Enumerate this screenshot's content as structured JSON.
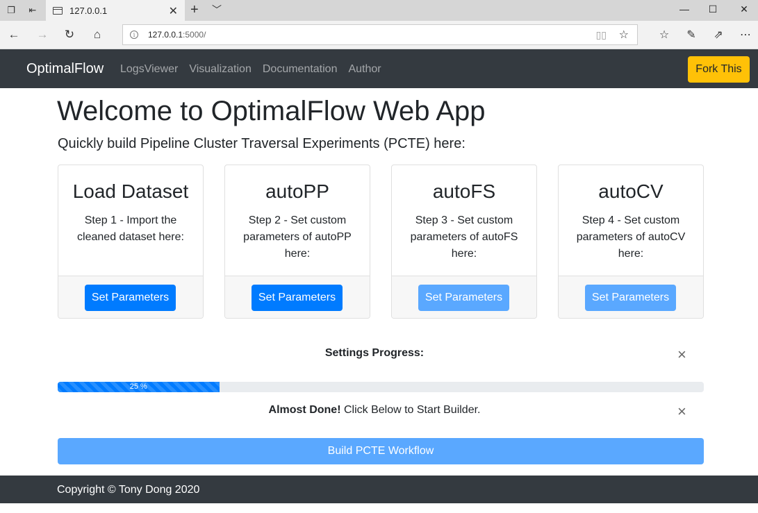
{
  "browser": {
    "tab_title": "127.0.0.1",
    "new_tab_icon": "+",
    "url_host": "127.0.0.1",
    "url_port_path": ":5000/"
  },
  "navbar": {
    "brand": "OptimalFlow",
    "links": [
      "LogsViewer",
      "Visualization",
      "Documentation",
      "Author"
    ],
    "fork_button": "Fork This"
  },
  "header": {
    "title": "Welcome to OptimalFlow Web App",
    "subtitle": "Quickly build Pipeline Cluster Traversal Experiments (PCTE) here:"
  },
  "cards": [
    {
      "title": "Load Dataset",
      "text": "Step 1 - Import the cleaned dataset here:",
      "button": "Set Parameters",
      "enabled": true
    },
    {
      "title": "autoPP",
      "text": "Step 2 - Set custom parameters of autoPP here:",
      "button": "Set Parameters",
      "enabled": true
    },
    {
      "title": "autoFS",
      "text": "Step 3 - Set custom parameters of autoFS here:",
      "button": "Set Parameters",
      "enabled": false
    },
    {
      "title": "autoCV",
      "text": "Step 4 - Set custom parameters of autoCV here:",
      "button": "Set Parameters",
      "enabled": false
    }
  ],
  "progress": {
    "label": "Settings Progress:",
    "value_text": "25 %",
    "value": 0.25,
    "alert_bold": "Almost Done!",
    "alert_text": " Click Below to Start Builder."
  },
  "build_button": "Build PCTE Workflow",
  "footer": {
    "copyright": "Copyright © Tony Dong 2020"
  },
  "colors": {
    "primary": "#007bff",
    "warning": "#ffc107",
    "dark": "#343a40"
  }
}
